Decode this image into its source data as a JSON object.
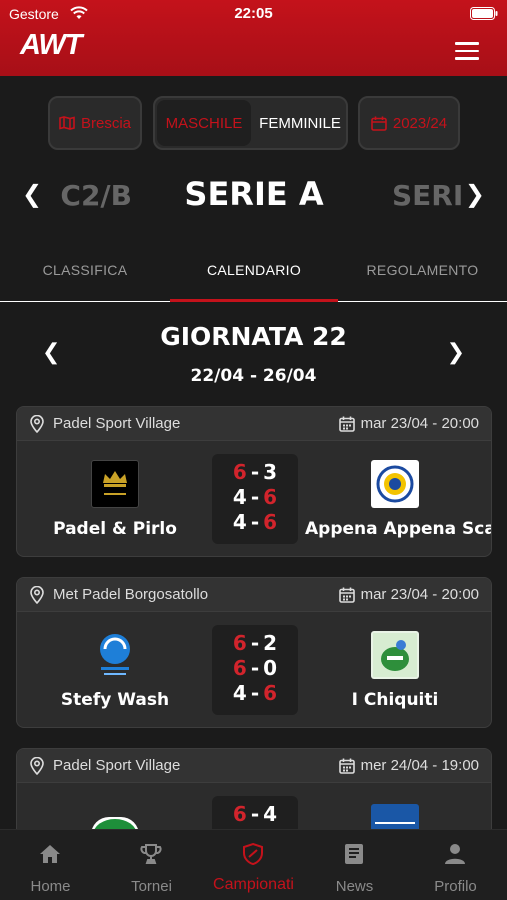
{
  "status": {
    "carrier": "Gestore",
    "time": "22:05"
  },
  "header": {
    "logo": "AWT"
  },
  "filters": {
    "city": "Brescia",
    "gender_male": "MASCHILE",
    "gender_female": "FEMMINILE",
    "season": "2023/24",
    "accent_color": "#c4121b"
  },
  "league": {
    "prev": "C2/B",
    "current": "SERIE A",
    "next": "SERIE"
  },
  "tabs": {
    "classifica": "CLASSIFICA",
    "calendario": "CALENDARIO",
    "regolamento": "REGOLAMENTO"
  },
  "round": {
    "title": "GIORNATA 22",
    "dates": "22/04 - 26/04"
  },
  "matches": [
    {
      "venue": "Padel Sport Village",
      "when": "mar 23/04 - 20:00",
      "home": "Padel & Pirlo",
      "away": "Appena Appena Scarsi",
      "sets": [
        {
          "home": "6",
          "away": "3",
          "winner": "home"
        },
        {
          "home": "4",
          "away": "6",
          "winner": "away"
        },
        {
          "home": "4",
          "away": "6",
          "winner": "away"
        }
      ]
    },
    {
      "venue": "Met Padel Borgosatollo",
      "when": "mar 23/04 - 20:00",
      "home": "Stefy Wash",
      "away": "I Chiquiti",
      "sets": [
        {
          "home": "6",
          "away": "2",
          "winner": "home"
        },
        {
          "home": "6",
          "away": "0",
          "winner": "home"
        },
        {
          "home": "4",
          "away": "6",
          "winner": "away"
        }
      ]
    },
    {
      "venue": "Padel Sport Village",
      "when": "mer 24/04 - 19:00",
      "home": "",
      "away": "",
      "sets": [
        {
          "home": "6",
          "away": "4",
          "winner": "home"
        }
      ]
    }
  ],
  "nav": {
    "home": "Home",
    "tornei": "Tornei",
    "campionati": "Campionati",
    "news": "News",
    "profilo": "Profilo"
  }
}
